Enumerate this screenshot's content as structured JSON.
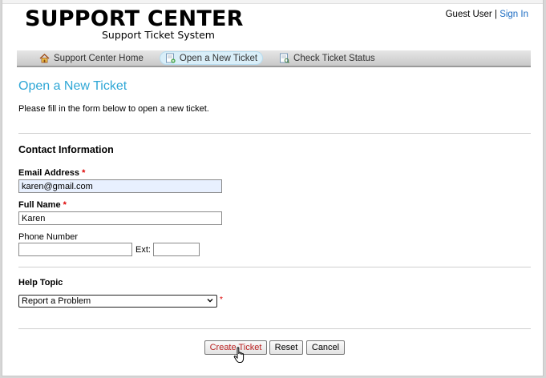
{
  "header": {
    "logo_title": "SUPPORT CENTER",
    "logo_subtitle": "Support Ticket System",
    "guest_label": "Guest User",
    "separator": "|",
    "sign_in": "Sign In"
  },
  "nav": {
    "items": [
      {
        "label": "Support Center Home",
        "icon": "home-icon",
        "active": false
      },
      {
        "label": "Open a New Ticket",
        "icon": "new-ticket-icon",
        "active": true
      },
      {
        "label": "Check Ticket Status",
        "icon": "ticket-status-icon",
        "active": false
      }
    ]
  },
  "main": {
    "title": "Open a New Ticket",
    "intro": "Please fill in the form below to open a new ticket."
  },
  "contact": {
    "section_title": "Contact Information",
    "email_label": "Email Address",
    "email_value": "karen@gmail.com",
    "name_label": "Full Name",
    "name_value": "Karen",
    "phone_label": "Phone Number",
    "phone_value": "",
    "ext_label": "Ext:",
    "ext_value": "",
    "required_mark": "*"
  },
  "help": {
    "section_title": "Help Topic",
    "selected": "Report a Problem",
    "required_mark": "*"
  },
  "buttons": {
    "create": "Create Ticket",
    "reset": "Reset",
    "cancel": "Cancel"
  },
  "colors": {
    "title_blue": "#2fa7d6",
    "link_blue": "#1a6bc2",
    "required_red": "#dd0000",
    "autofill_bg": "#e8f0fe"
  }
}
